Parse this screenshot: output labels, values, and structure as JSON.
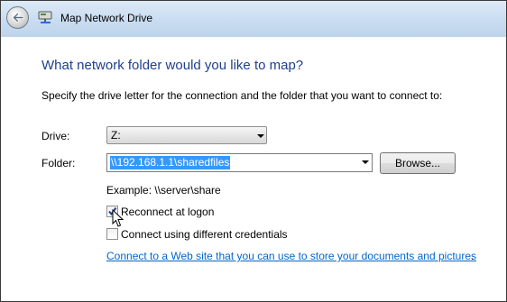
{
  "window": {
    "title": "Map Network Drive"
  },
  "main": {
    "heading": "What network folder would you like to map?",
    "instruction": "Specify the drive letter for the connection and the folder that you want to connect to:",
    "drive": {
      "label": "Drive:",
      "value": "Z:"
    },
    "folder": {
      "label": "Folder:",
      "value": "\\\\192.168.1.1\\sharedfiles",
      "browse_label": "Browse..."
    },
    "example": "Example: \\\\server\\share",
    "reconnect": {
      "label": "Reconnect at logon",
      "checked": true
    },
    "credentials": {
      "label": "Connect using different credentials",
      "checked": false
    },
    "link": {
      "text": "Connect to a Web site that you can use to store your documents and pictures",
      "suffix": "."
    }
  },
  "colors": {
    "heading": "#1e3f8f",
    "link": "#0066cc",
    "selection": "#3399ff",
    "titlebar": "#c9dcf0"
  },
  "icons": {
    "back": "back-arrow-icon",
    "network": "network-drive-icon",
    "cursor": "mouse-pointer-icon"
  }
}
